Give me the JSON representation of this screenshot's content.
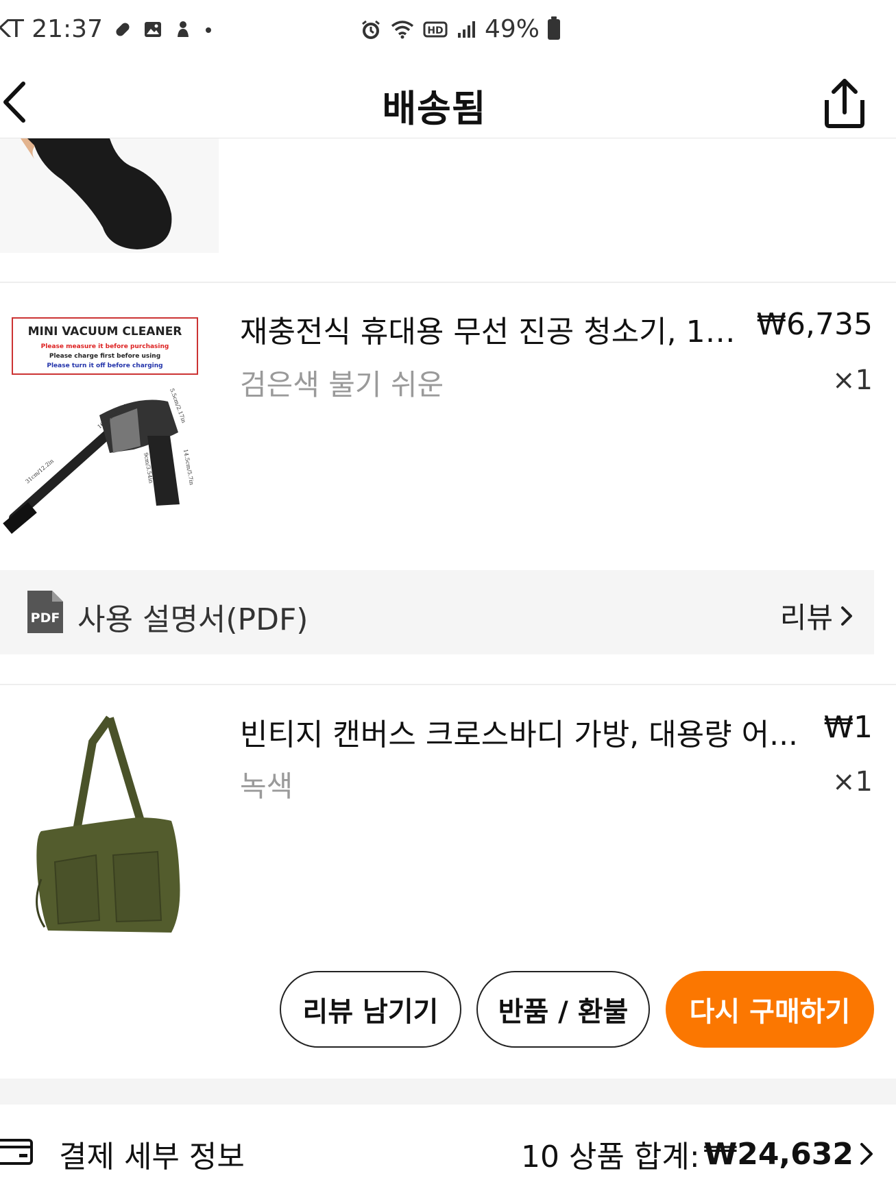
{
  "status_bar": {
    "carrier_time": "KT 21:37",
    "battery": "49%",
    "icons_left": [
      "pill-icon",
      "gallery-icon",
      "app-icon",
      "dot-icon"
    ],
    "icons_right": [
      "alarm-icon",
      "wifi-icon",
      "hd-icon",
      "signal-icon",
      "battery-icon"
    ]
  },
  "header": {
    "title": "배송됨",
    "back_icon": "chevron-left-icon",
    "share_icon": "share-icon"
  },
  "products": [
    {
      "name": "재충전식 휴대용 무선 진공 청소기, 12...",
      "price": "₩6,735",
      "variant": "검은색 불기 쉬운",
      "qty": "×1",
      "image_text": {
        "title": "MINI VACUUM CLEANER",
        "line1": "Please measure it before purchasing",
        "line2": "Please charge first before using",
        "line3": "Please turn it off before charging",
        "dim1": "16.5cm/6.5in",
        "dim2": "31cm/12.2in",
        "dim3": "5.5cm/2.17in",
        "dim4": "14.5cm/5.7in",
        "dim5": "9cm/3.54in"
      }
    },
    {
      "name": "빈티지 캔버스 크로스바디 가방, 대용량 어...",
      "price": "₩1",
      "variant": "녹색",
      "qty": "×1"
    }
  ],
  "manual": {
    "icon_text": "PDF",
    "label": "사용 설명서(PDF)",
    "review_label": "리뷰"
  },
  "actions": {
    "leave_review": "리뷰 남기기",
    "return_refund": "반품 / 환불",
    "buy_again": "다시 구매하기"
  },
  "payment": {
    "label": "결제 세부 정보",
    "summary_prefix": "10 상품 합계:",
    "summary_total": "₩24,632"
  },
  "colors": {
    "accent": "#fb7701",
    "muted_text": "#9a9a9a",
    "band": "#f5f5f5"
  }
}
